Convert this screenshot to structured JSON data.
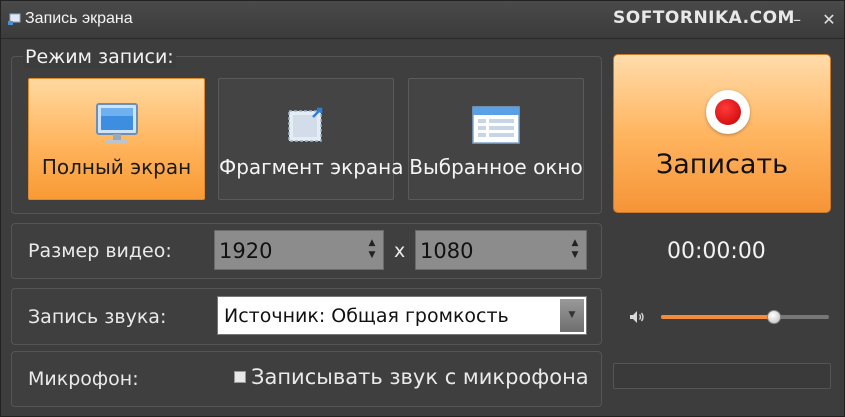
{
  "window": {
    "title": "Запись экрана",
    "watermark": "SOFTORNIKA.COM",
    "minimize_glyph": "–",
    "close_glyph": "✕"
  },
  "mode": {
    "title": "Режим записи:",
    "options": [
      {
        "label": "Полный экран",
        "icon": "monitor-icon",
        "selected": true
      },
      {
        "label": "Фрагмент экрана",
        "icon": "region-select-icon",
        "selected": false
      },
      {
        "label": "Выбранное окно",
        "icon": "window-icon",
        "selected": false
      }
    ]
  },
  "record": {
    "label": "Записать",
    "timer": "00:00:00"
  },
  "video_size": {
    "label": "Размер видео:",
    "width": "1920",
    "height": "1080",
    "separator": "x"
  },
  "audio": {
    "label": "Запись звука:",
    "source": "Источник: Общая громкость",
    "volume_fraction": 0.67
  },
  "mic": {
    "label": "Микрофон:",
    "checkbox_label": "Записывать звук с микрофона",
    "checked": false
  },
  "colors": {
    "accent": "#f89a35",
    "record_red": "#d40000",
    "background": "#3d3d3d"
  }
}
